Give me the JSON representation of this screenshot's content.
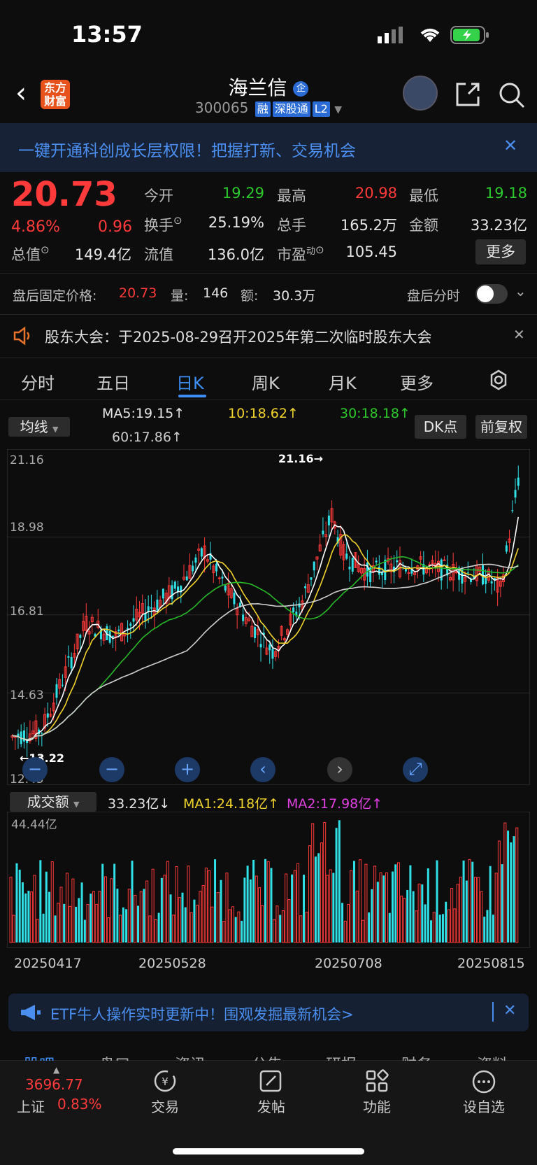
{
  "status": {
    "time": "13:57"
  },
  "header": {
    "back": "‹",
    "logo_line1": "东方",
    "logo_line2": "财富",
    "title": "海兰信",
    "title_badge": "企",
    "code": "300065",
    "tags": [
      "融",
      "深股通",
      "L2"
    ]
  },
  "banner": {
    "text": "一键开通科创成长层权限！把握打新、交易机会",
    "close": "✕"
  },
  "quote": {
    "price": "20.73",
    "pct": "4.86%",
    "change": "0.96",
    "open_label": "今开",
    "open": "19.29",
    "high_label": "最高",
    "high": "20.98",
    "low_label": "最低",
    "low": "19.18",
    "turnover_label": "换手",
    "turnover": "25.19%",
    "volume_label": "总手",
    "volume": "165.2万",
    "amount_label": "金额",
    "amount": "33.23亿",
    "mktcap_label": "总值",
    "mktcap": "149.4亿",
    "float_label": "流值",
    "float": "136.0亿",
    "pe_label": "市盈",
    "pe_sup": "动",
    "pe": "105.45",
    "more": "更多"
  },
  "after_hours": {
    "label": "盘后固定价格:",
    "price": "20.73",
    "qty_label": "量:",
    "qty": "146",
    "amt_label": "额:",
    "amt": "30.3万",
    "toggle_label": "盘后分时"
  },
  "notice": {
    "text": "股东大会：于2025-08-29召开2025年第二次临时股东大会",
    "close": "✕"
  },
  "tabs": [
    "分时",
    "五日",
    "日K",
    "周K",
    "月K",
    "更多"
  ],
  "ma_bar": {
    "selector": "均线",
    "ma5": "MA5:19.15↑",
    "ma10": "10:18.62↑",
    "ma30": "30:18.18↑",
    "ma60": "60:17.86↑",
    "dk": "DK点",
    "fq": "前复权"
  },
  "price_axis": [
    "21.16",
    "18.98",
    "16.81",
    "14.63",
    "12.45"
  ],
  "annotations": {
    "high": "21.16→",
    "low": "←13.22"
  },
  "controls": {
    "minus": "−",
    "plus": "+",
    "left": "‹",
    "right": "›",
    "expand": "⤢"
  },
  "volume_bar": {
    "selector": "成交额",
    "val": "33.23亿↓",
    "ma1": "MA1:24.18亿↑",
    "ma2": "MA2:17.98亿↑",
    "axis_top": "44.44亿"
  },
  "dates": [
    "20250417",
    "20250528",
    "20250708",
    "20250815"
  ],
  "etf": {
    "text": "ETF牛人操作实时更新中！围观发掘最新机会>",
    "close": "✕"
  },
  "bottom_tabs_hidden": [
    "股吧",
    "盘口",
    "资讯",
    "公告",
    "研报",
    "财务",
    "资料"
  ],
  "tabbar": {
    "index_value": "3696.77",
    "index_name": "上证",
    "index_pct": "0.83%",
    "trade": "交易",
    "post": "发帖",
    "func": "功能",
    "watch": "设自选"
  },
  "colors": {
    "up": "#ff3a3a",
    "down": "#2fe0e6",
    "ma5": "#ffffff",
    "ma10": "#f1d32c",
    "ma30": "#28b828",
    "ma60": "#cfcfcf",
    "accent": "#3d8ef5"
  },
  "chart_data": {
    "type": "candlestick",
    "ylim": [
      12.45,
      21.16
    ],
    "y_ticks": [
      21.16,
      18.98,
      16.81,
      14.63,
      12.45
    ],
    "x_ticks": [
      "20250417",
      "20250528",
      "20250708",
      "20250815"
    ],
    "high_marker": 21.16,
    "low_marker": 13.22,
    "last_close": 20.73,
    "ma_latest": {
      "ma5": 19.15,
      "ma10": 18.62,
      "ma30": 18.18,
      "ma60": 17.86
    },
    "volume_axis_max": "44.44亿",
    "volume_latest": {
      "value": "33.23亿",
      "ma1": "24.18亿",
      "ma2": "17.98亿"
    }
  }
}
